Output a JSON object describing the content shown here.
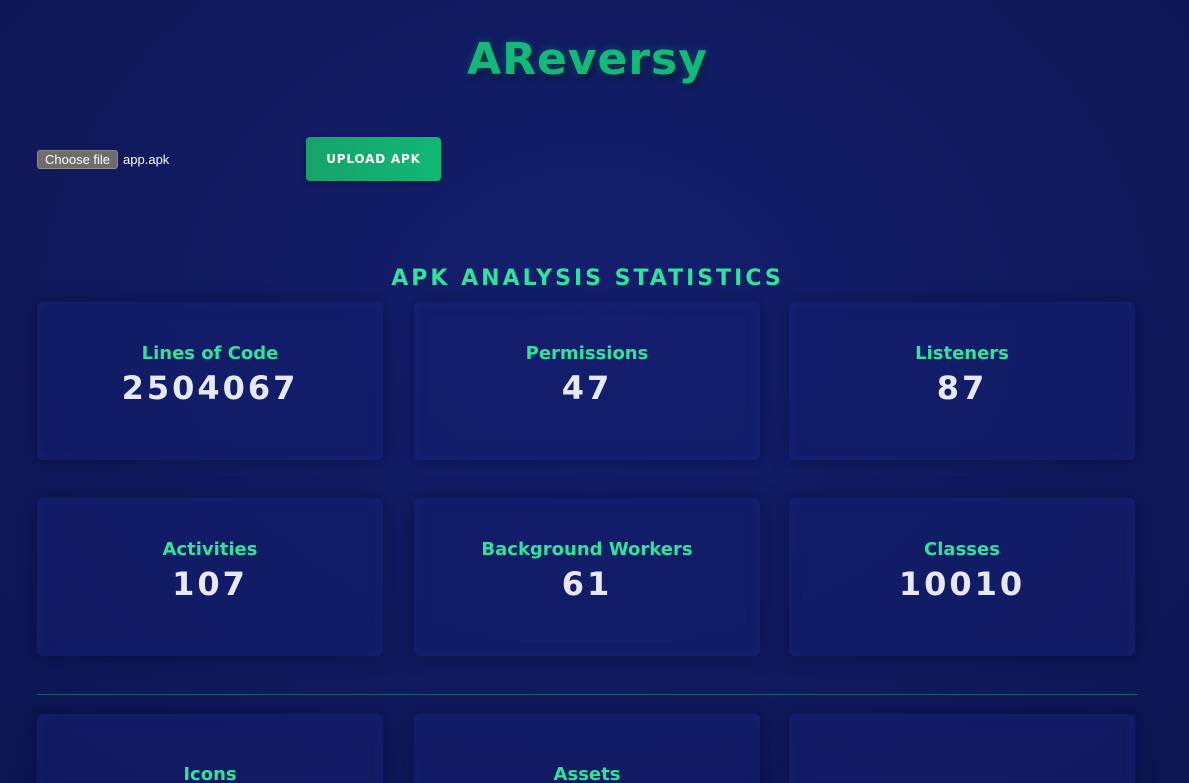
{
  "app": {
    "title": "AReversy"
  },
  "upload": {
    "choose_file_label": "Choose file",
    "file_name": "app.apk",
    "upload_button_label": "UPLOAD APK"
  },
  "stats": {
    "section_title": "APK ANALYSIS STATISTICS",
    "cards": [
      {
        "label": "Lines of Code",
        "value": "2504067"
      },
      {
        "label": "Permissions",
        "value": "47"
      },
      {
        "label": "Listeners",
        "value": "87"
      },
      {
        "label": "Activities",
        "value": "107"
      },
      {
        "label": "Background Workers",
        "value": "61"
      },
      {
        "label": "Classes",
        "value": "10010"
      }
    ],
    "more_cards": [
      {
        "label": "Icons"
      },
      {
        "label": "Assets"
      },
      {
        "label": ""
      }
    ]
  },
  "colors": {
    "accent": "#2fe39a",
    "brand": "#13b87a",
    "background": "#111a5e",
    "button": "#10b874"
  }
}
